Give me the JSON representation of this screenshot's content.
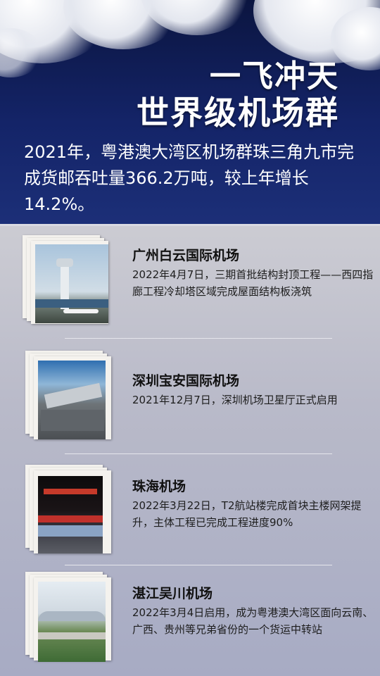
{
  "header": {
    "title_line1": "一飞冲天",
    "title_line2": "世界级机场群",
    "intro": "2021年，粤港澳大湾区机场群珠三角九市完成货邮吞吐量366.2万吨，较上年增长14.2%。"
  },
  "airports": [
    {
      "name": "广州白云国际机场",
      "desc": "2022年4月7日，三期首批结构封顶工程——西四指廊工程冷却塔区域完成屋面结构板浇筑"
    },
    {
      "name": "深圳宝安国际机场",
      "desc": "2021年12月7日，深圳机场卫星厅正式启用"
    },
    {
      "name": "珠海机场",
      "desc": "2022年3月22日，T2航站楼完成首块主楼网架提升，主体工程已完成工程进度90%"
    },
    {
      "name": "湛江吴川机场",
      "desc": "2022年3月4日启用，成为粤港澳大湾区面向云南、广西、贵州等兄弟省份的一个货运中转站"
    }
  ]
}
